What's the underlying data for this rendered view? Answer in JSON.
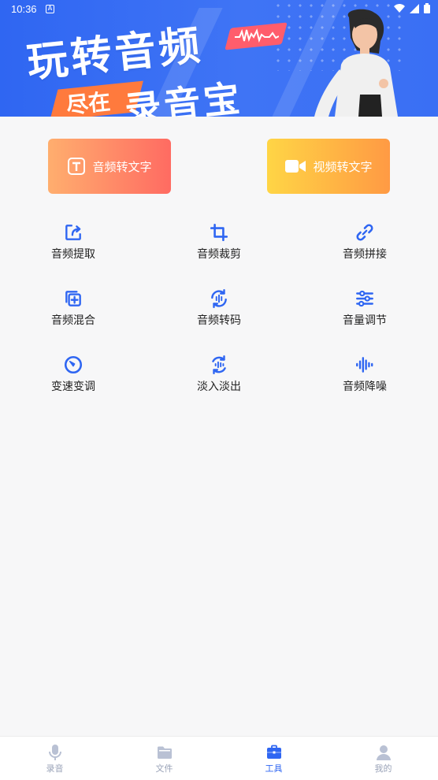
{
  "status_bar": {
    "time": "10:36",
    "notification_letter": "A"
  },
  "banner": {
    "headline": "玩转音频",
    "subline_left": "尽在",
    "subline_right": "录音宝"
  },
  "primary_buttons": [
    {
      "label": "音频转文字",
      "icon": "text-icon"
    },
    {
      "label": "视频转文字",
      "icon": "video-icon"
    }
  ],
  "tools": [
    {
      "label": "音频提取",
      "icon": "extract-icon"
    },
    {
      "label": "音频裁剪",
      "icon": "crop-icon"
    },
    {
      "label": "音频拼接",
      "icon": "link-icon"
    },
    {
      "label": "音频混合",
      "icon": "mix-icon"
    },
    {
      "label": "音频转码",
      "icon": "transcode-icon"
    },
    {
      "label": "音量调节",
      "icon": "sliders-icon"
    },
    {
      "label": "变速变调",
      "icon": "speed-dial-icon"
    },
    {
      "label": "淡入淡出",
      "icon": "fade-icon"
    },
    {
      "label": "音频降噪",
      "icon": "noise-reduction-icon"
    }
  ],
  "bottom_nav": {
    "active_index": 2,
    "items": [
      {
        "label": "录音",
        "icon": "microphone-icon"
      },
      {
        "label": "文件",
        "icon": "folder-icon"
      },
      {
        "label": "工具",
        "icon": "toolbox-icon"
      },
      {
        "label": "我的",
        "icon": "person-icon"
      }
    ]
  },
  "colors": {
    "accent": "#2f66f2",
    "inactive": "#9aa3b8"
  }
}
